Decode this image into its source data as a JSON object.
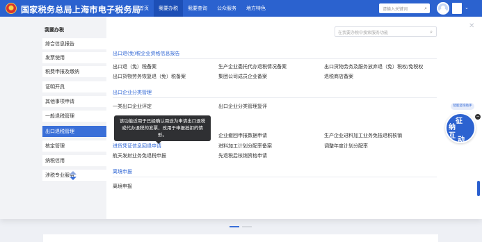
{
  "header": {
    "site_title": "国家税务总局上海市电子税务局",
    "nav": [
      "首页",
      "我要办税",
      "我要查询",
      "公众服务",
      "地方特色"
    ],
    "active_nav": "我要办税",
    "search_placeholder": "请输入关键词",
    "brand_color": "#2b62cf"
  },
  "sidebar": {
    "title": "我要办税",
    "items": [
      "综合信息报告",
      "发票使用",
      "税费申报及缴纳",
      "证明开具",
      "其他事项申请",
      "一般退税管理",
      "出口退税管理",
      "核定管理",
      "纳税信用",
      "涉税专业服务"
    ],
    "active_item": "出口退税管理"
  },
  "panel": {
    "search_placeholder": "在我要办税中搜索服务功能",
    "sections": [
      {
        "title": "出口退(免)税企业资格信息报告",
        "services": [
          "出口退（免）税备案",
          "生产企业委托代办退税情况备案",
          "出口货物劳务及服务放弃退（免）税权/免税权",
          "出口货物劳务恢复退（免）税备案",
          "集团公司成员企业备案",
          "退税商店备案"
        ]
      },
      {
        "title": "出口企业分类管理",
        "services": [
          "一类出口企业评定",
          "出口企业分类管理复评",
          "企业撤回申报数据申请",
          "生产企业进料加工业务免抵退税核销",
          "进货凭证信息回退申请",
          "进料加工计划分配率备案",
          "调整年度计划分配率",
          "航天发射业务免退税申报",
          "先退税后核销资格申请"
        ]
      },
      {
        "title": "离境申报",
        "services": [
          "离境申报"
        ]
      }
    ],
    "tooltip": "该功能适用于已经确认用途为申请出口退税或代办退税的发票，改用于申报抵扣的情形。"
  },
  "assistant": {
    "tag": "智能咨询助手",
    "chars": [
      "征",
      "纳",
      "互",
      "动"
    ]
  }
}
